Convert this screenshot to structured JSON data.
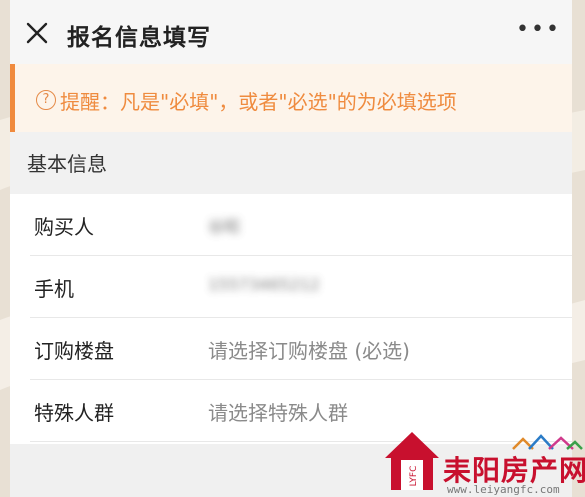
{
  "header": {
    "title": "报名信息填写",
    "more_label": "•••"
  },
  "notice": {
    "icon": "?",
    "text": "提醒：凡是\"必填\"，或者\"必选\"的为必填选项"
  },
  "section": {
    "title": "基本信息"
  },
  "form": {
    "rows": [
      {
        "label": "购买人",
        "value": "谷昭"
      },
      {
        "label": "手机",
        "value": "15573465212"
      },
      {
        "label": "订购楼盘",
        "value": "请选择订购楼盘 (必选)"
      },
      {
        "label": "特殊人群",
        "value": "请选择特殊人群"
      }
    ]
  },
  "watermark": {
    "brand": "耒阳房产网",
    "url": "www.leiyangfc.com",
    "badge": "LYFC"
  },
  "colors": {
    "accent": "#ef8b3f",
    "brand": "#c8102e"
  }
}
